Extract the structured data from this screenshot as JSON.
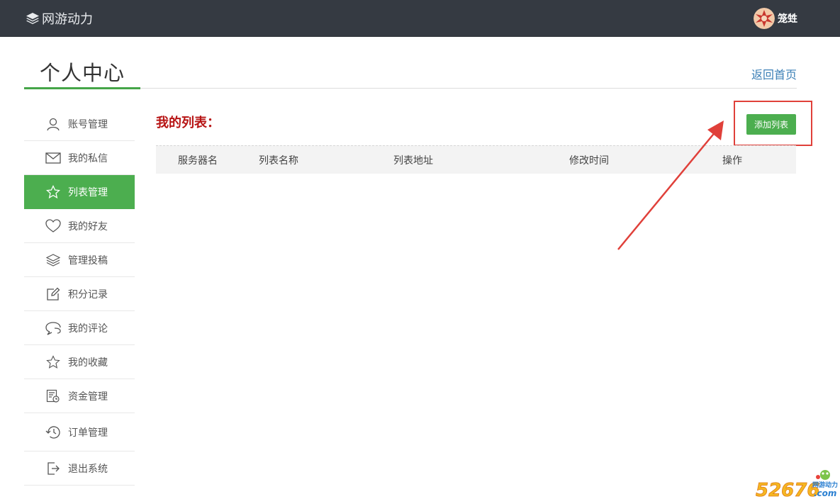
{
  "topbar": {
    "brand": "网游动力",
    "user_name": "笼甡"
  },
  "header": {
    "title": "个人中心",
    "home_link": "返回首页"
  },
  "sidebar": {
    "items": [
      {
        "label": "账号管理",
        "icon": "user-icon",
        "active": false
      },
      {
        "label": "我的私信",
        "icon": "mail-icon",
        "active": false
      },
      {
        "label": "列表管理",
        "icon": "star-icon",
        "active": true
      },
      {
        "label": "我的好友",
        "icon": "heart-icon",
        "active": false
      },
      {
        "label": "管理投稿",
        "icon": "layers-icon",
        "active": false
      },
      {
        "label": "积分记录",
        "icon": "edit-icon",
        "active": false
      },
      {
        "label": "我的评论",
        "icon": "comment-icon",
        "active": false
      },
      {
        "label": "我的收藏",
        "icon": "star-outline-icon",
        "active": false
      },
      {
        "label": "资金管理",
        "icon": "finance-icon",
        "active": false
      },
      {
        "label": "订单管理",
        "icon": "history-icon",
        "active": false
      },
      {
        "label": "退出系统",
        "icon": "logout-icon",
        "active": false
      }
    ]
  },
  "main": {
    "section_title": "我的列表：",
    "add_button": "添加列表",
    "table_headers": [
      "服务器名",
      "列表名称",
      "列表地址",
      "修改时间",
      "操作"
    ]
  },
  "colors": {
    "topbar": "#353a42",
    "accent_green": "#4cae4f",
    "section_title": "#b71414",
    "link_blue": "#3b7fb6",
    "annotation_red": "#e0403a"
  },
  "watermark": {
    "digits": "52676",
    "domain": ".com",
    "site": "网游动力"
  }
}
